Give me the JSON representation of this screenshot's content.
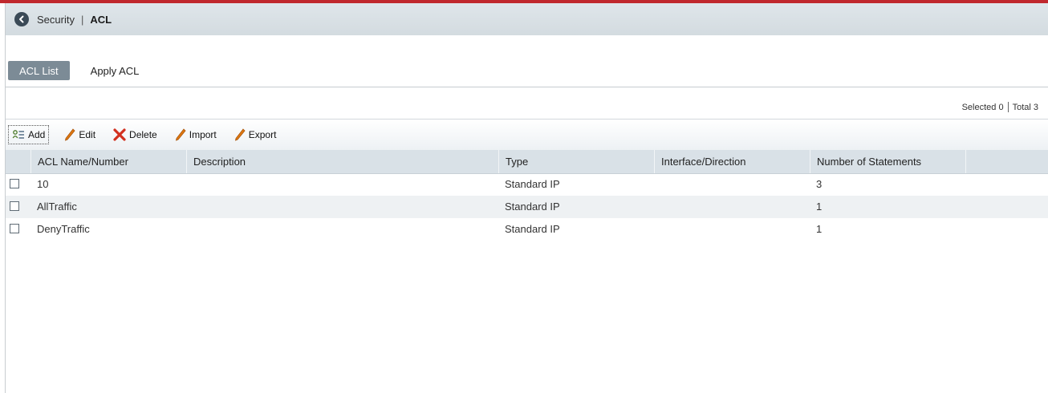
{
  "breadcrumb": {
    "section": "Security",
    "separator": "|",
    "page": "ACL"
  },
  "tabs": [
    {
      "label": "ACL List",
      "active": true
    },
    {
      "label": "Apply ACL",
      "active": false
    }
  ],
  "status": {
    "selected": "Selected 0",
    "total": "Total 3"
  },
  "toolbar": {
    "add_label": "Add",
    "edit_label": "Edit",
    "delete_label": "Delete",
    "import_label": "Import",
    "export_label": "Export"
  },
  "table": {
    "columns": [
      "ACL Name/Number",
      "Description",
      "Type",
      "Interface/Direction",
      "Number of Statements"
    ],
    "rows": [
      {
        "name": "10",
        "description": "",
        "type": "Standard IP",
        "interface": "",
        "statements": "3"
      },
      {
        "name": "AllTraffic",
        "description": "",
        "type": "Standard IP",
        "interface": "",
        "statements": "1"
      },
      {
        "name": "DenyTraffic",
        "description": "",
        "type": "Standard IP",
        "interface": "",
        "statements": "1"
      }
    ]
  },
  "colors": {
    "accent_rule": "#c0282d",
    "active_tab": "#7c8b96",
    "delete_icon": "#d2301f",
    "edit_icon": "#e07a12"
  }
}
